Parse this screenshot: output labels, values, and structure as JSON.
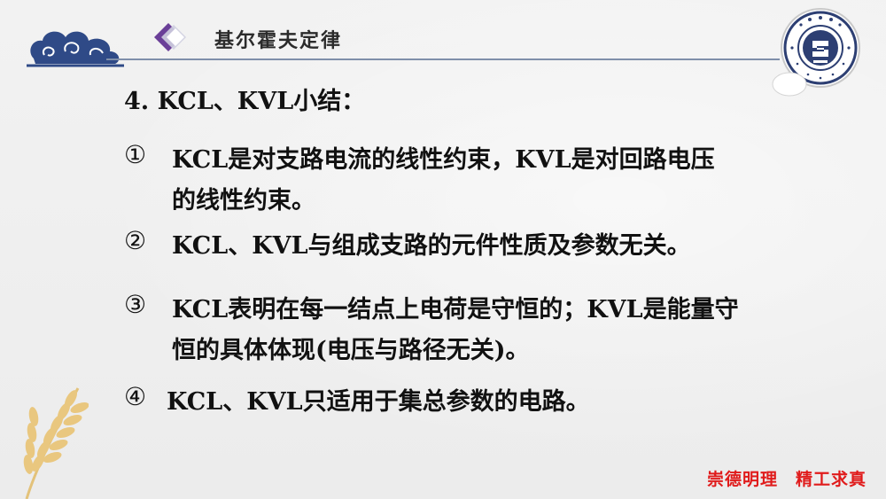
{
  "header": {
    "title": "基尔霍夫定律"
  },
  "logo": {
    "name": "school-seal-logo",
    "text": "SHAANXI INSTITUTE OF SCIENCE AND TECHNOLOGY"
  },
  "content": {
    "heading": "4.  KCL、KVL小结：",
    "items": [
      {
        "marker": "①",
        "lines": [
          "KCL是对支路电流的线性约束，KVL是对回路电压",
          "的线性约束。"
        ]
      },
      {
        "marker": "②",
        "lines": [
          "KCL、KVL与组成支路的元件性质及参数无关。"
        ]
      },
      {
        "marker": "③",
        "lines": [
          "KCL表明在每一结点上电荷是守恒的；KVL是能量守",
          "恒的具体体现(电压与路径无关)。"
        ]
      },
      {
        "marker": "④",
        "lines": [
          "KCL、KVL只适用于集总参数的电路。"
        ]
      }
    ]
  },
  "footer": {
    "motto": "崇德明理　精工求真"
  },
  "colors": {
    "accent_line": "#7f8faa",
    "cloud": "#2f4a87",
    "diamond_purple": "#6a3f98",
    "motto_red": "#e01b1b"
  }
}
